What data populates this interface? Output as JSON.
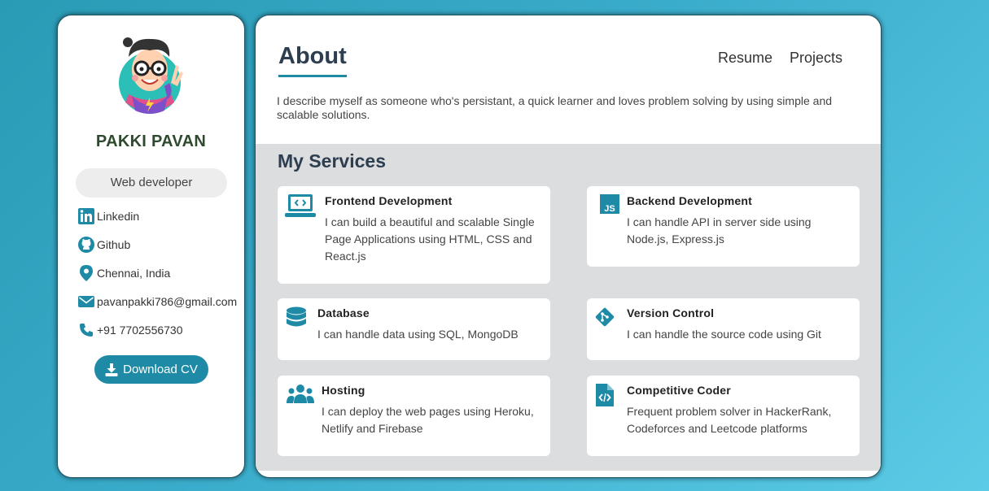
{
  "profile": {
    "name": "PAKKI PAVAN",
    "role": "Web developer",
    "contacts": {
      "linkedin": "Linkedin",
      "github": "Github",
      "location": "Chennai, India",
      "email": "pavanpakki786@gmail.com",
      "phone": "+91 7702556730"
    },
    "download_label": "Download CV"
  },
  "nav": {
    "resume": "Resume",
    "projects": "Projects"
  },
  "about": {
    "title": "About",
    "text": "I describe myself as someone who's persistant, a quick learner and loves problem solving by using simple and scalable solutions."
  },
  "services": {
    "title": "My Services",
    "items": [
      {
        "title": "Frontend Development",
        "desc": "I can build a beautiful and scalable Single Page Applications using HTML, CSS and React.js",
        "icon": "laptop-code-icon"
      },
      {
        "title": "Backend Development",
        "desc": "I can handle API in server side using Node.js, Express.js",
        "icon": "js-icon"
      },
      {
        "title": "Database",
        "desc": "I can handle data using SQL, MongoDB",
        "icon": "database-icon"
      },
      {
        "title": "Version Control",
        "desc": "I can handle the source code using Git",
        "icon": "git-icon"
      },
      {
        "title": "Hosting",
        "desc": "I can deploy the web pages using Heroku, Netlify and Firebase",
        "icon": "users-icon"
      },
      {
        "title": "Competitive Coder",
        "desc": "Frequent problem solver in HackerRank, Codeforces and Leetcode platforms",
        "icon": "file-code-icon"
      }
    ]
  },
  "colors": {
    "accent": "#1e8aa6",
    "heading": "#2c3e50",
    "services_bg": "#dcdddf"
  }
}
